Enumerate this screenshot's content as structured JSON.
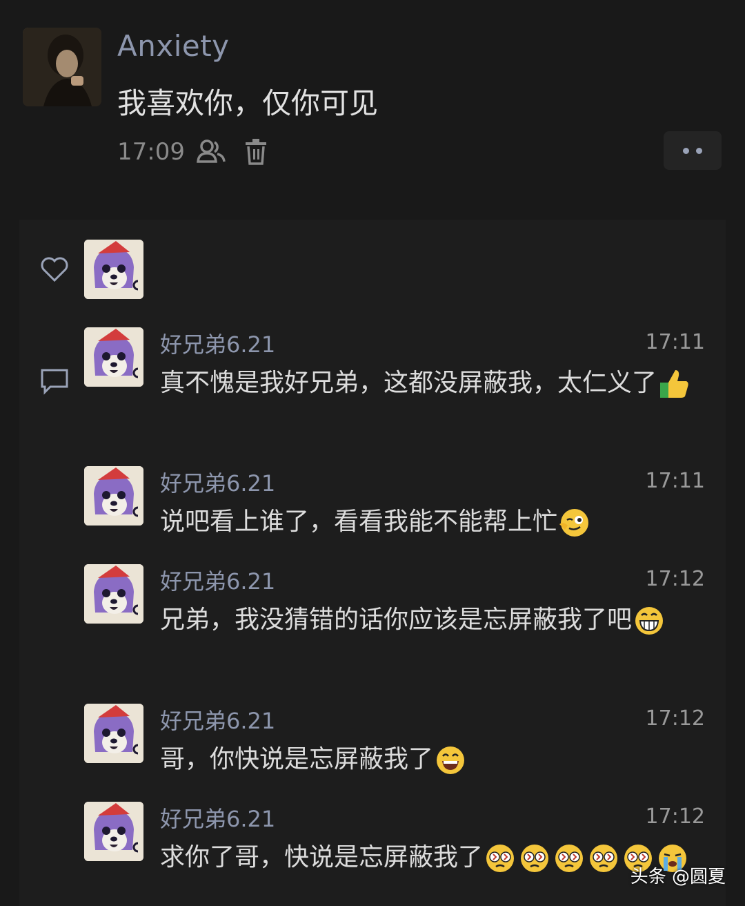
{
  "post": {
    "author": "Anxiety",
    "text": "我喜欢你，仅你可见",
    "time": "17:09",
    "icons": [
      "visibility-people-icon",
      "delete-icon",
      "more-icon"
    ]
  },
  "likes": {
    "icon": "heart-icon"
  },
  "comments": [
    {
      "name": "好兄弟6.21",
      "time": "17:11",
      "text": "真不愧是我好兄弟，这都没屏蔽我，太仁义了",
      "emojis": [
        "thumbs-up"
      ]
    },
    {
      "name": "好兄弟6.21",
      "time": "17:11",
      "text": "说吧看上谁了，看看我能不能帮上忙",
      "emojis": [
        "wink"
      ]
    },
    {
      "name": "好兄弟6.21",
      "time": "17:12",
      "text": "兄弟，我没猜错的话你应该是忘屏蔽我了吧",
      "emojis": [
        "grin"
      ]
    },
    {
      "name": "好兄弟6.21",
      "time": "17:12",
      "text": "哥，你快说是忘屏蔽我了",
      "emojis": [
        "smile"
      ]
    },
    {
      "name": "好兄弟6.21",
      "time": "17:12",
      "text": "求你了哥，快说是忘屏蔽我了",
      "emojis": [
        "broken",
        "broken",
        "broken",
        "broken",
        "broken",
        "cry"
      ]
    }
  ],
  "watermark": "头条 @圆夏",
  "colors": {
    "background": "#191919",
    "name": "#8d96ad",
    "text": "#dcdcdc"
  }
}
